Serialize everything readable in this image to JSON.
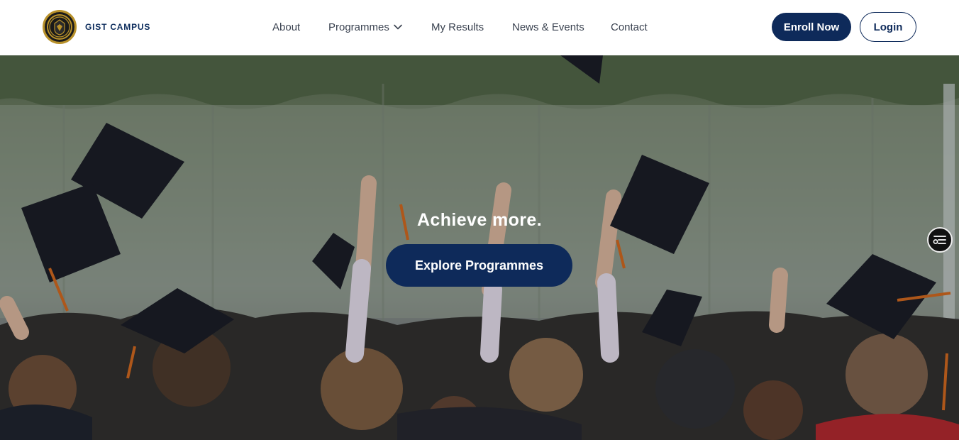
{
  "header": {
    "brand": "GIST CAMPUS",
    "nav": {
      "about": "About",
      "programmes": "Programmes",
      "my_results": "My Results",
      "news_events": "News & Events",
      "contact": "Contact"
    },
    "enroll_label": "Enroll Now",
    "login_label": "Login"
  },
  "hero": {
    "tagline": "Achieve more.",
    "cta_label": "Explore Programmes"
  },
  "colors": {
    "primary": "#0e2a5a",
    "nav_text": "#3a4250",
    "logo_gold": "#b8912a"
  },
  "icons": {
    "logo": "campus-crest",
    "programmes_dropdown": "chevron-down-icon",
    "floating_widget": "filter-sliders-icon"
  }
}
